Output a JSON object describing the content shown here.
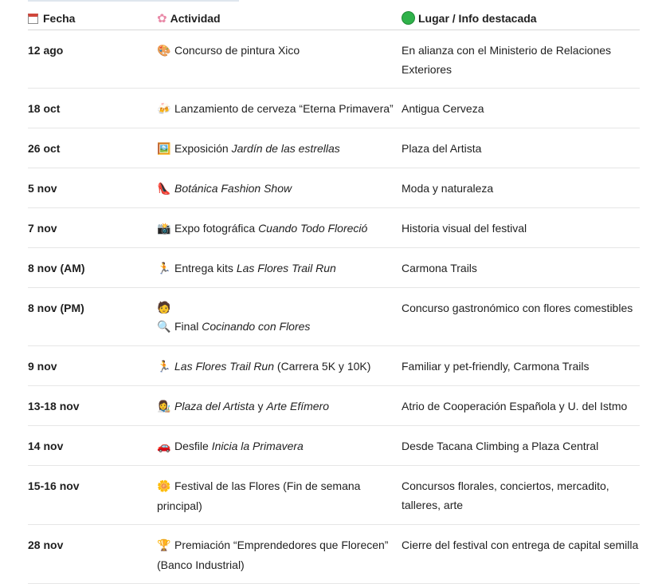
{
  "headers": {
    "fecha": "Fecha",
    "actividad": "Actividad",
    "lugar": "Lugar / Info destacada"
  },
  "rows": [
    {
      "fecha": "12 ago",
      "icon": "🎨",
      "parts": [
        {
          "t": "Concurso de pintura Xico",
          "i": false
        }
      ],
      "lugar": "En alianza con el Ministerio de Relaciones Exteriores"
    },
    {
      "fecha": "18 oct",
      "icon": "🍻",
      "parts": [
        {
          "t": "Lanzamiento de cerveza “Eterna Primavera”",
          "i": false
        }
      ],
      "lugar": "Antigua Cerveza"
    },
    {
      "fecha": "26 oct",
      "icon": "🖼️",
      "parts": [
        {
          "t": "Exposición ",
          "i": false
        },
        {
          "t": "Jardín de las estrellas",
          "i": true
        }
      ],
      "lugar": "Plaza del Artista"
    },
    {
      "fecha": "5 nov",
      "icon": "👠",
      "parts": [
        {
          "t": "Botánica Fashion Show",
          "i": true
        }
      ],
      "lugar": "Moda y naturaleza"
    },
    {
      "fecha": "7 nov",
      "icon": "📸",
      "parts": [
        {
          "t": "Expo fotográfica ",
          "i": false
        },
        {
          "t": "Cuando Todo Floreció",
          "i": true
        }
      ],
      "lugar": "Historia visual del festival"
    },
    {
      "fecha": "8 nov (AM)",
      "icon": "🏃",
      "parts": [
        {
          "t": "Entrega kits ",
          "i": false
        },
        {
          "t": "Las Flores Trail Run",
          "i": true
        }
      ],
      "lugar": "Carmona Trails"
    },
    {
      "fecha": "8 nov (PM)",
      "icon": "🧑🔍",
      "parts": [
        {
          "t": "Final ",
          "i": false
        },
        {
          "t": "Cocinando con Flores",
          "i": true
        }
      ],
      "lugar": "Concurso gastronómico con flores comestibles"
    },
    {
      "fecha": "9 nov",
      "icon": "🏃",
      "parts": [
        {
          "t": "Las Flores Trail Run",
          "i": true
        },
        {
          "t": " (Carrera 5K y 10K)",
          "i": false
        }
      ],
      "lugar": "Familiar y pet-friendly, Carmona Trails"
    },
    {
      "fecha": "13-18 nov",
      "icon": "👩‍🎨",
      "parts": [
        {
          "t": "Plaza del Artista",
          "i": true
        },
        {
          "t": " y ",
          "i": false
        },
        {
          "t": "Arte Efímero",
          "i": true
        }
      ],
      "lugar": "Atrio de Cooperación Española y U. del Istmo"
    },
    {
      "fecha": "14 nov",
      "icon": "🚗",
      "parts": [
        {
          "t": "Desfile ",
          "i": false
        },
        {
          "t": "Inicia la Primavera",
          "i": true
        }
      ],
      "lugar": "Desde Tacana Climbing a Plaza Central"
    },
    {
      "fecha": "15-16 nov",
      "icon": "🌼",
      "parts": [
        {
          "t": "Festival de las Flores (Fin de semana principal)",
          "i": false
        }
      ],
      "lugar": "Concursos florales, conciertos, mercadito, talleres, arte"
    },
    {
      "fecha": "28 nov",
      "icon": "🏆",
      "parts": [
        {
          "t": "Premiación “Emprendedores que Florecen” (Banco Industrial)",
          "i": false
        }
      ],
      "lugar": "Cierre del festival con entrega de capital semilla"
    }
  ]
}
